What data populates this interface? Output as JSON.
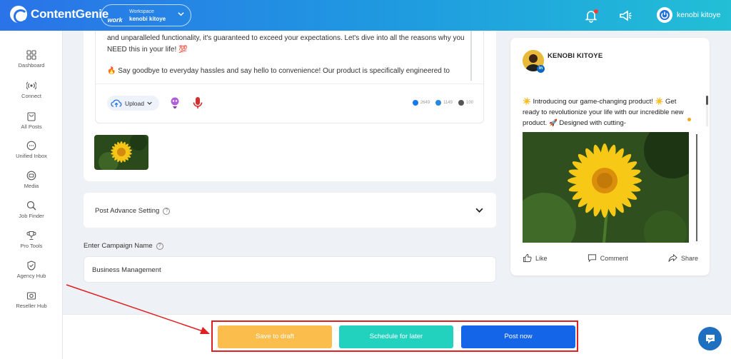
{
  "header": {
    "brand": "ContentGenie",
    "workspace": {
      "label": "Workspace",
      "name": "kenobi kitoye",
      "badge": "work"
    },
    "user": {
      "name": "kenobi kitoye"
    }
  },
  "sidebar": {
    "items": [
      {
        "label": "Dashboard",
        "icon": "grid-icon"
      },
      {
        "label": "Connect",
        "icon": "broadcast-icon"
      },
      {
        "label": "All Posts",
        "icon": "bag-icon"
      },
      {
        "label": "Unified Inbox",
        "icon": "chat-icon"
      },
      {
        "label": "Media",
        "icon": "media-icon"
      },
      {
        "label": "Job Finder",
        "icon": "search-icon"
      },
      {
        "label": "Pro Tools",
        "icon": "trophy-icon"
      },
      {
        "label": "Agency Hub",
        "icon": "shield-icon"
      },
      {
        "label": "Reseller Hub",
        "icon": "camera-icon"
      }
    ]
  },
  "editor": {
    "paragraph_1": "and unparalleled functionality, it's guaranteed to exceed your expectations. Let's dive into all the reasons why you NEED this in your life! 💯",
    "paragraph_2": "🔥 Say goodbye to everyday hassles and say hello to convenience! Our product is specifically engineered to",
    "upload_label": "Upload",
    "counts": {
      "facebook": "2649",
      "linkedin": "1149",
      "tiktok": "100"
    }
  },
  "advance_setting": {
    "title": "Post Advance Setting"
  },
  "campaign": {
    "label": "Enter Campaign Name",
    "value": "Business Management"
  },
  "preview": {
    "author": "KENOBI KITOYE",
    "text": "☀️ Introducing our game-changing product! ☀️ Get ready to revolutionize your life with our incredible new product. 🚀 Designed with cutting-",
    "actions": {
      "like": "Like",
      "comment": "Comment",
      "share": "Share"
    }
  },
  "actions": {
    "save_draft": "Save to draft",
    "schedule": "Schedule for later",
    "post_now": "Post now"
  },
  "colors": {
    "draft": "#fbbd4c",
    "schedule": "#22d2bf",
    "post": "#1565e8",
    "highlight": "#e02020"
  }
}
